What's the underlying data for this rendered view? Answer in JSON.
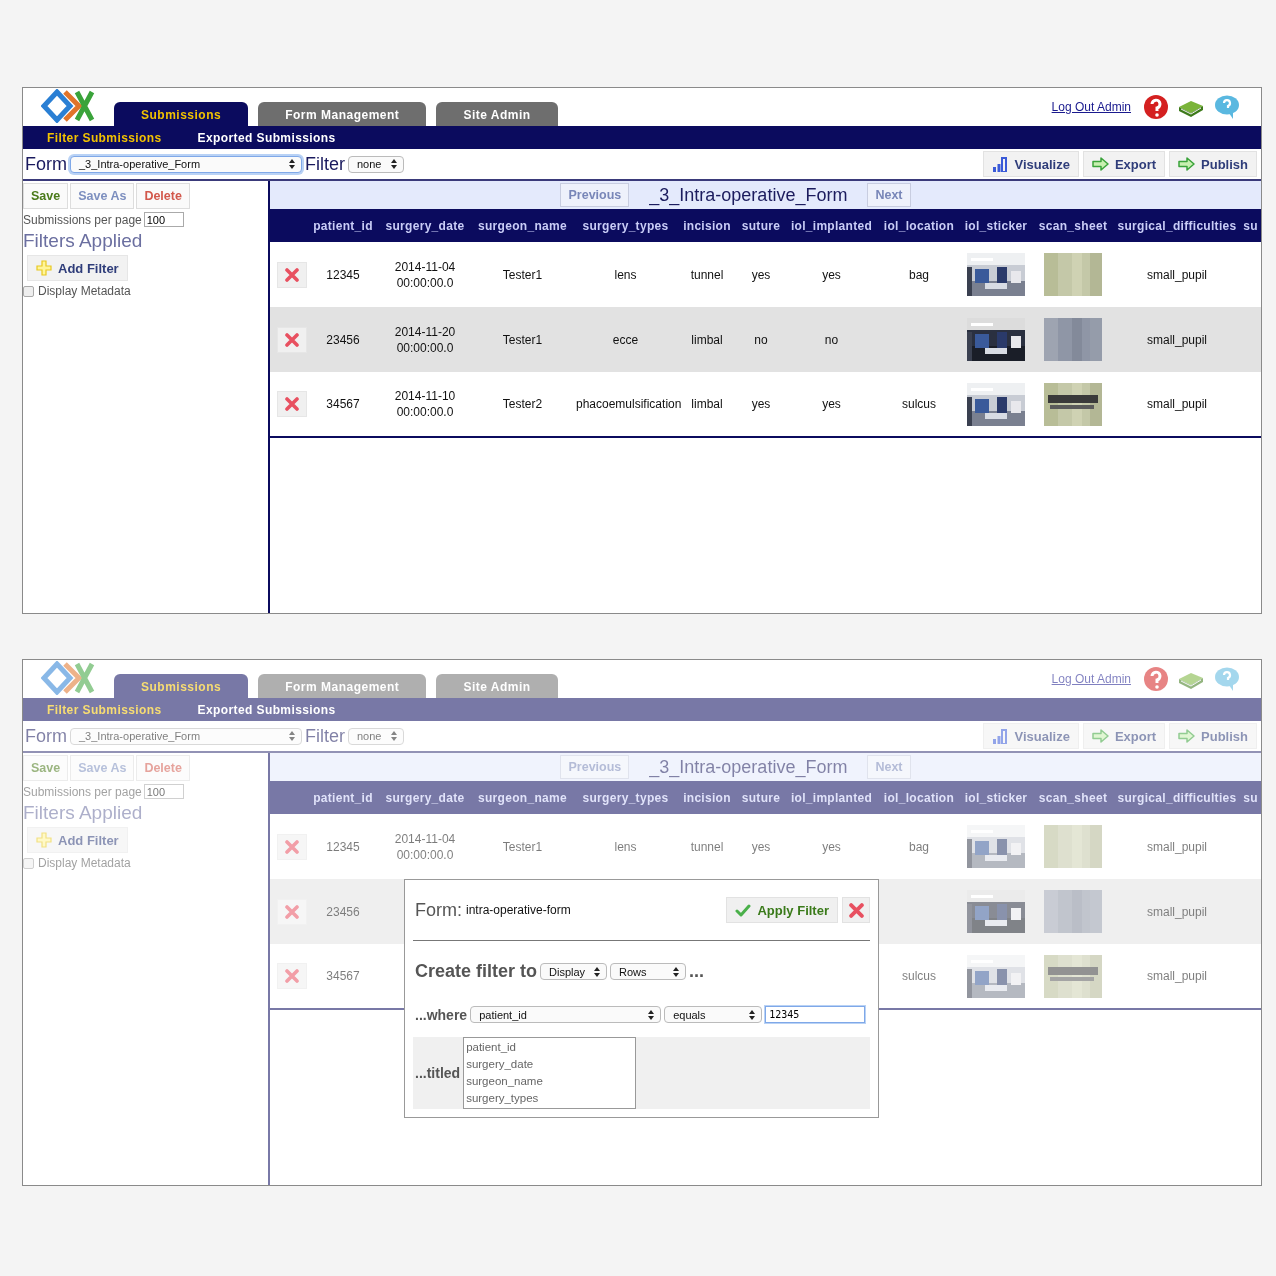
{
  "screens": [
    {
      "dimmed": false,
      "header": {
        "tabs": [
          {
            "label": "Submissions",
            "selected": true
          },
          {
            "label": "Form Management",
            "selected": false
          },
          {
            "label": "Site Admin",
            "selected": false
          }
        ],
        "logout": "Log Out Admin"
      },
      "subnav": [
        {
          "label": "Filter Submissions",
          "selected": true
        },
        {
          "label": "Exported Submissions",
          "selected": false
        }
      ],
      "form_bar": {
        "form_label": "Form",
        "form_value": "_3_Intra-operative_Form",
        "form_focused": true,
        "filter_label": "Filter",
        "filter_value": "none",
        "actions": [
          {
            "label": "Visualize",
            "kind": "chart"
          },
          {
            "label": "Export",
            "kind": "arrow"
          },
          {
            "label": "Publish",
            "kind": "arrow"
          }
        ]
      },
      "sidebar": {
        "buttons": [
          {
            "label": "Save",
            "kind": "positive"
          },
          {
            "label": "Save As",
            "kind": "neutral"
          },
          {
            "label": "Delete",
            "kind": "danger"
          }
        ],
        "per_page_label": "Submissions per page",
        "per_page_value": "100",
        "filters_title": "Filters Applied",
        "add_filter": "Add Filter",
        "metadata": {
          "label": "Display Metadata",
          "checked": false
        }
      },
      "pager": {
        "previous": {
          "label": "Previous",
          "disabled": true
        },
        "title": "_3_Intra-operative_Form",
        "next": {
          "label": "Next",
          "disabled": true
        }
      },
      "table": {
        "columns": [
          "patient_id",
          "surgery_date",
          "surgeon_name",
          "surgery_types",
          "incision",
          "suture",
          "iol_implanted",
          "iol_location",
          "iol_sticker",
          "scan_sheet",
          "surgical_difficulties",
          "su"
        ],
        "rows": [
          {
            "cells": [
              "12345",
              "2014-11-04 00:00:00.0",
              "Tester1",
              "lens",
              "tunnel",
              "yes",
              "yes",
              "bag",
              {
                "kind": "picture"
              },
              {
                "kind": "picture"
              },
              "small_pupil",
              null
            ]
          },
          {
            "cells": [
              "23456",
              "2014-11-20 00:00:00.0",
              "Tester1",
              "ecce",
              "limbal",
              "no",
              "no",
              null,
              {
                "kind": "picture"
              },
              {
                "kind": "picture"
              },
              "small_pupil",
              null
            ]
          },
          {
            "cells": [
              "34567",
              "2014-11-10 00:00:00.0",
              "Tester2",
              "phacoemulsification",
              "limbal",
              "yes",
              "yes",
              "sulcus",
              {
                "kind": "picture"
              },
              {
                "kind": "picture"
              },
              "small_pupil",
              null
            ]
          }
        ]
      }
    },
    {
      "dimmed": true,
      "header": {
        "tabs": [
          {
            "label": "Submissions",
            "selected": true
          },
          {
            "label": "Form Management",
            "selected": false
          },
          {
            "label": "Site Admin",
            "selected": false
          }
        ],
        "logout": "Log Out Admin"
      },
      "subnav": [
        {
          "label": "Filter Submissions",
          "selected": true
        },
        {
          "label": "Exported Submissions",
          "selected": false
        }
      ],
      "form_bar": {
        "form_label": "Form",
        "form_value": "_3_Intra-operative_Form",
        "form_focused": false,
        "filter_label": "Filter",
        "filter_value": "none",
        "actions": [
          {
            "label": "Visualize",
            "kind": "chart"
          },
          {
            "label": "Export",
            "kind": "arrow"
          },
          {
            "label": "Publish",
            "kind": "arrow"
          }
        ]
      },
      "sidebar": {
        "buttons": [
          {
            "label": "Save",
            "kind": "positive"
          },
          {
            "label": "Save As",
            "kind": "neutral"
          },
          {
            "label": "Delete",
            "kind": "danger"
          }
        ],
        "per_page_label": "Submissions per page",
        "per_page_value": "100",
        "filters_title": "Filters Applied",
        "add_filter": "Add Filter",
        "metadata": {
          "label": "Display Metadata",
          "checked": false
        }
      },
      "pager": {
        "previous": {
          "label": "Previous",
          "disabled": true
        },
        "title": "_3_Intra-operative_Form",
        "next": {
          "label": "Next",
          "disabled": true
        }
      },
      "table": {
        "columns": [
          "patient_id",
          "surgery_date",
          "surgeon_name",
          "surgery_types",
          "incision",
          "suture",
          "iol_implanted",
          "iol_location",
          "iol_sticker",
          "scan_sheet",
          "surgical_difficulties",
          "su"
        ],
        "rows": [
          {
            "cells": [
              "12345",
              "2014-11-04 00:00:00.0",
              "Tester1",
              "lens",
              "tunnel",
              "yes",
              "yes",
              "bag",
              {
                "kind": "picture"
              },
              {
                "kind": "picture"
              },
              "small_pupil",
              null
            ]
          },
          {
            "cells": [
              "23456",
              null,
              null,
              null,
              null,
              null,
              null,
              null,
              {
                "kind": "picture"
              },
              {
                "kind": "picture"
              },
              "small_pupil",
              null
            ]
          },
          {
            "cells": [
              "34567",
              null,
              null,
              null,
              null,
              null,
              null,
              "sulcus",
              {
                "kind": "picture"
              },
              {
                "kind": "picture"
              },
              "small_pupil",
              null
            ]
          }
        ]
      },
      "modal": {
        "form_label": "Form:",
        "form_name": "intra-operative-form",
        "apply": "Apply Filter",
        "create_label": "Create filter to",
        "action_value": "Display",
        "target_value": "Rows",
        "ellipsis": "...",
        "where_label": "...where",
        "field_value": "patient_id",
        "operator_value": "equals",
        "input_value": "12345",
        "input_focused": true,
        "titled_label": "...titled",
        "titled_options": [
          "patient_id",
          "surgery_date",
          "surgeon_name",
          "surgery_types"
        ]
      }
    }
  ]
}
